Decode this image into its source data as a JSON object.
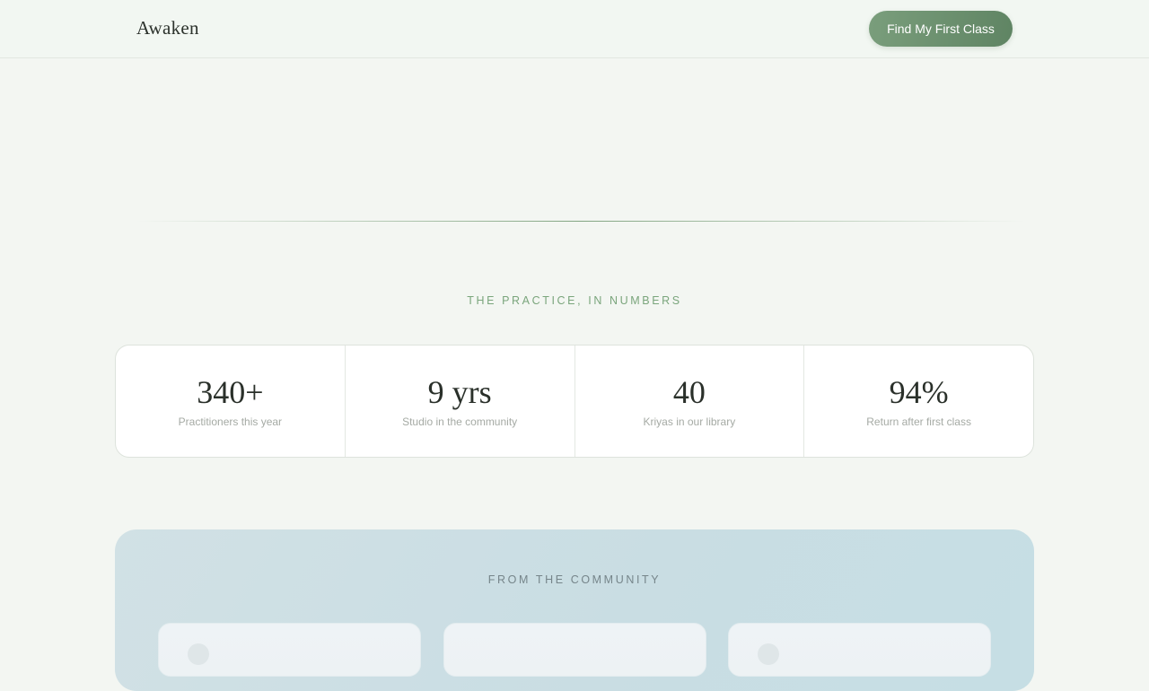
{
  "header": {
    "brand": "Awaken",
    "cta_label": "Find My First Class"
  },
  "numbers_section": {
    "eyebrow": "THE PRACTICE, IN NUMBERS",
    "stats": [
      {
        "value": "340+",
        "label": "Practitioners this year"
      },
      {
        "value": "9 yrs",
        "label": "Studio in the community"
      },
      {
        "value": "40",
        "label": "Kriyas in our library"
      },
      {
        "value": "94%",
        "label": "Return after first class"
      }
    ]
  },
  "community_section": {
    "eyebrow": "FROM THE COMMUNITY"
  },
  "colors": {
    "accent": "#6f9472",
    "eyebrow_green": "#7aa57c",
    "page_bg": "#f3f6f2",
    "community_bg": "#cddfe4"
  }
}
